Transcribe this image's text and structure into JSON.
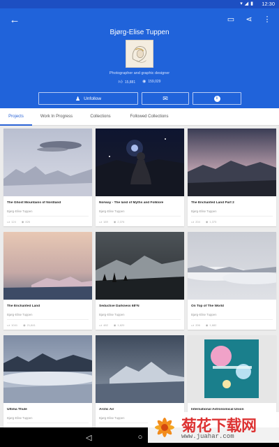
{
  "status_bar": {
    "time": "12:30",
    "icons": [
      "wifi-icon",
      "signal-icon",
      "battery-icon"
    ]
  },
  "header": {
    "profile_name": "Bjørg-Elise Tuppen",
    "tagline": "Photographer and graphic designer",
    "appreciations": "15,881",
    "views": "159,029",
    "actions": {
      "unfollow": "Unfollow"
    },
    "colors": {
      "background": "#2063da",
      "statusbar": "#1d4fc2"
    }
  },
  "tabs": [
    {
      "label": "Projects",
      "active": true
    },
    {
      "label": "Work In Progress",
      "active": false
    },
    {
      "label": "Collections",
      "active": false
    },
    {
      "label": "Followed Collections",
      "active": false
    }
  ],
  "cards": [
    {
      "title": "The Ghost Mountains of Nordland",
      "author": "Bjørg-Elise Tuppen",
      "likes": "124",
      "views": "826"
    },
    {
      "title": "Norway - The land of Myths and Folklore",
      "author": "Bjørg-Elise Tuppen",
      "likes": "189",
      "views": "2,376"
    },
    {
      "title": "The Enchanted Land Part 2",
      "author": "Bjørg-Elise Tuppen",
      "likes": "204",
      "views": "1,375"
    },
    {
      "title": "The Enchanted Land",
      "author": "Bjørg-Elise Tuppen",
      "likes": "1041",
      "views": "21,841"
    },
    {
      "title": "Seductive Darkness 68°N",
      "author": "Bjørg-Elise Tuppen",
      "likes": "482",
      "views": "1,620"
    },
    {
      "title": "On Top of The World",
      "author": "Bjørg-Elise Tuppen",
      "likes": "206",
      "views": "1,682"
    },
    {
      "title": "Ultima Thule",
      "author": "Bjørg-Elise Tuppen",
      "likes": "",
      "views": ""
    },
    {
      "title": "Arctic Air",
      "author": "Bjørg-Elise Tuppen",
      "likes": "",
      "views": ""
    },
    {
      "title": "International Astronomical Union",
      "author": "",
      "likes": "",
      "views": ""
    }
  ],
  "watermark": {
    "text": "菊花下载网",
    "url": "www.juahar.com"
  }
}
